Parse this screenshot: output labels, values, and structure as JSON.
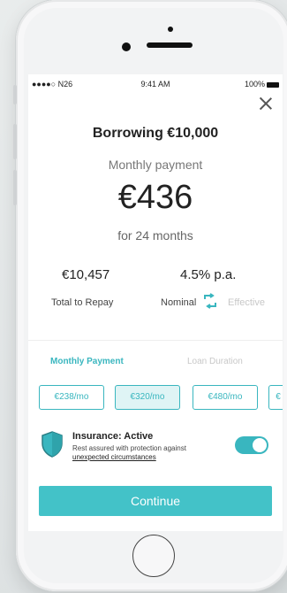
{
  "status": {
    "carrier": "●●●●○ N26",
    "time": "9:41 AM",
    "battery": "100%"
  },
  "header": {
    "title": "Borrowing €10,000"
  },
  "payment": {
    "label": "Monthly payment",
    "amount": "€436",
    "period": "for 24 months"
  },
  "summary": {
    "total_value": "€10,457",
    "total_label": "Total to Repay",
    "rate_value": "4.5% p.a.",
    "nominal_label": "Nominal",
    "effective_label": "Effective"
  },
  "tabs": [
    {
      "label": "Monthly Payment"
    },
    {
      "label": "Loan Duration"
    }
  ],
  "options": [
    {
      "label": "€238/mo"
    },
    {
      "label": "€320/mo"
    },
    {
      "label": "€480/mo"
    },
    {
      "label": "€"
    }
  ],
  "insurance": {
    "title": "Insurance: Active",
    "line1": "Rest assured with protection against",
    "line2": "unexpected circumstances",
    "enabled": true
  },
  "cta": {
    "label": "Continue"
  },
  "colors": {
    "accent": "#39b6bf",
    "button": "#43c2c8",
    "selected_chip": "#dff4f5"
  }
}
